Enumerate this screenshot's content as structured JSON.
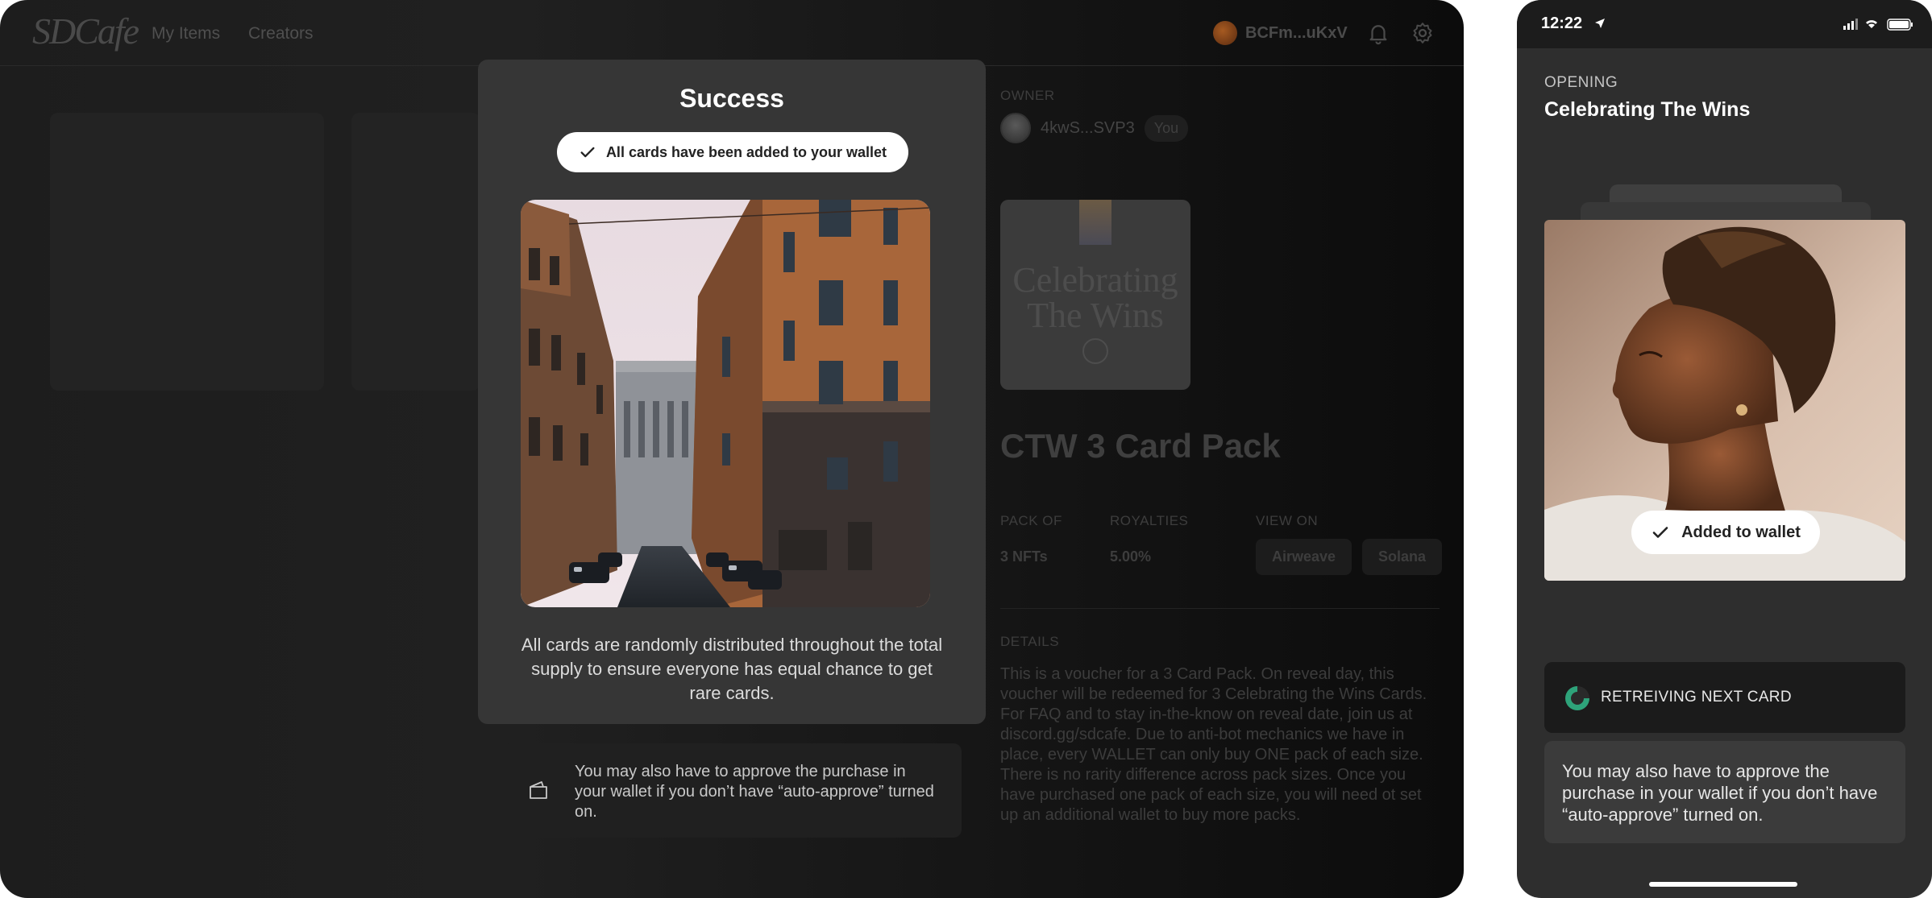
{
  "desktop": {
    "nav": {
      "logo": "SDCafe",
      "my_items": "My Items",
      "creators": "Creators"
    },
    "account": {
      "address": "BCFm...uKxV"
    },
    "icons": {
      "bell": "bell-icon",
      "settings": "gear-icon"
    },
    "product": {
      "owner_label": "OWNER",
      "owner_address": "4kwS...SVP3",
      "owner_badge": "You",
      "voucher_text": "Celebrating The Wins",
      "title": "CTW 3 Card Pack",
      "pack_of_label": "PACK OF",
      "pack_of_value": "3 NFTs",
      "royalties_label": "ROYALTIES",
      "royalties_value": "5.00%",
      "view_on_label": "VIEW ON",
      "view_on_links": [
        "Airweave",
        "Solana"
      ],
      "details_label": "DETAILS",
      "details_text": "This is a voucher for a 3 Card Pack. On reveal day, this voucher will be redeemed for 3 Celebrating the Wins Cards. For FAQ and to stay in-the-know on reveal date, join us at discord.gg/sdcafe. Due to anti-bot mechanics we have in place, every WALLET can only buy ONE pack of each size. There is no rarity difference across pack sizes. Once you have purchased one pack of each size, you will need ot set up an additional wallet to buy more packs."
    },
    "modal": {
      "title": "Success",
      "pill": "All cards have been added to your wallet",
      "description": "All cards are randomly distributed throughout the total supply to ensure everyone has equal chance to get rare cards."
    },
    "note": {
      "icon": "wallet-icon",
      "text": "You may also have to approve the purchase in your wallet if you don’t have “auto-approve” turned on."
    }
  },
  "phone": {
    "status": {
      "time": "12:22"
    },
    "opening_label": "OPENING",
    "title": "Celebrating The Wins",
    "wallet_pill": "Added to wallet",
    "retrieving": "RETREIVING NEXT CARD",
    "note": "You may also have to approve the purchase in your wallet if you don’t have “auto-approve” turned on."
  },
  "colors": {
    "background": "#1d1d1d",
    "modal": "#363636",
    "pill": "#ffffff",
    "spinner_accent": "#2ea37a"
  }
}
